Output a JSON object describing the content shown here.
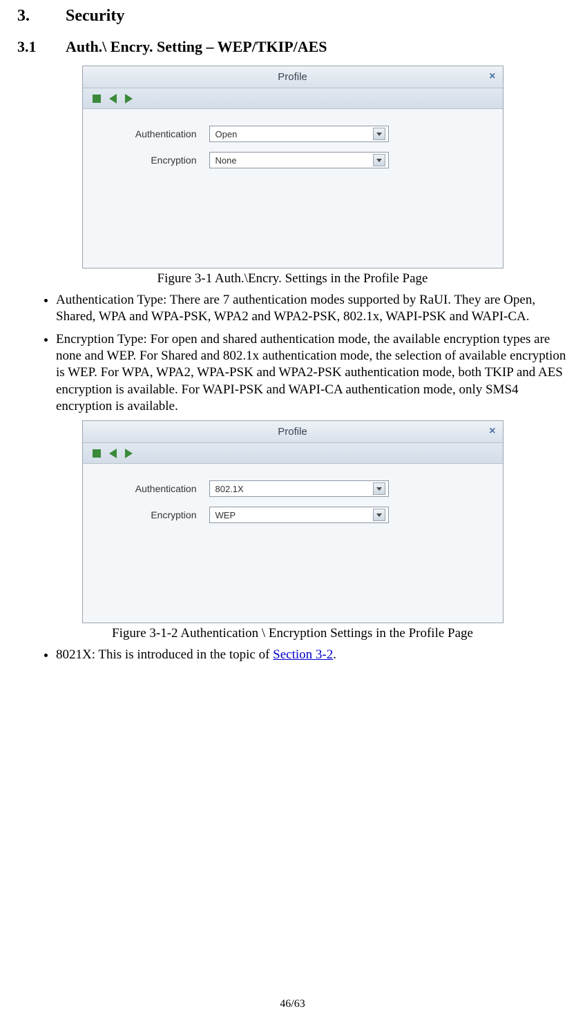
{
  "section": {
    "num": "3.",
    "title": "Security"
  },
  "subsection": {
    "num": "3.1",
    "title": "Auth.\\ Encry. Setting – WEP/TKIP/AES"
  },
  "panel1": {
    "title": "Profile",
    "auth_label": "Authentication",
    "enc_label": "Encryption",
    "auth_value": "Open",
    "enc_value": "None"
  },
  "caption1": "Figure 3-1 Auth.\\Encry. Settings in the Profile Page",
  "bullet1": "Authentication Type: There are 7 authentication modes supported by RaUI. They are Open, Shared, WPA and WPA-PSK, WPA2 and WPA2-PSK, 802.1x, WAPI-PSK and WAPI-CA.",
  "bullet2": "Encryption Type: For open and shared authentication mode, the available encryption types are none and WEP. For Shared and 802.1x authentication mode, the selection of available encryption is WEP. For WPA, WPA2, WPA-PSK and WPA2-PSK authentication mode, both TKIP and AES encryption is available. For WAPI-PSK and WAPI-CA authentication mode, only SMS4 encryption is available.",
  "panel2": {
    "title": "Profile",
    "auth_label": "Authentication",
    "enc_label": "Encryption",
    "auth_value": "802.1X",
    "enc_value": "WEP"
  },
  "caption2": "Figure 3-1-2 Authentication \\ Encryption Settings in the Profile Page",
  "bullet3_prefix": "8021X: This is introduced in the topic of ",
  "bullet3_link": "Section 3-2",
  "bullet3_suffix": ".",
  "page_number": "46/63"
}
